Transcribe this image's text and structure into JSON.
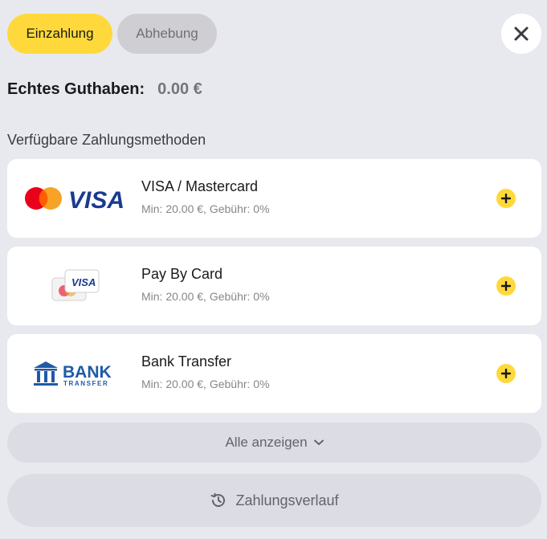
{
  "tabs": [
    {
      "label": "Einzahlung",
      "active": true
    },
    {
      "label": "Abhebung",
      "active": false
    }
  ],
  "balance": {
    "label": "Echtes Guthaben:",
    "value": "0.00 €"
  },
  "section_title": "Verfügbare Zahlungsmethoden",
  "methods": [
    {
      "name": "VISA / Mastercard",
      "meta": "Min: 20.00 €, Gebühr: 0%",
      "logo_text": "VISA"
    },
    {
      "name": "Pay By Card",
      "meta": "Min: 20.00 €, Gebühr: 0%",
      "logo_text": "VISA"
    },
    {
      "name": "Bank Transfer",
      "meta": "Min: 20.00 €, Gebühr: 0%",
      "logo_text": "BANK",
      "logo_subtext": "TRANSFER"
    }
  ],
  "show_all": {
    "label": "Alle anzeigen"
  },
  "history": {
    "label": "Zahlungsverlauf"
  },
  "colors": {
    "accent": "#ffd93b",
    "background": "#e8e9ef",
    "visa_blue": "#1a3a8f",
    "bank_blue": "#1f5aa6"
  }
}
